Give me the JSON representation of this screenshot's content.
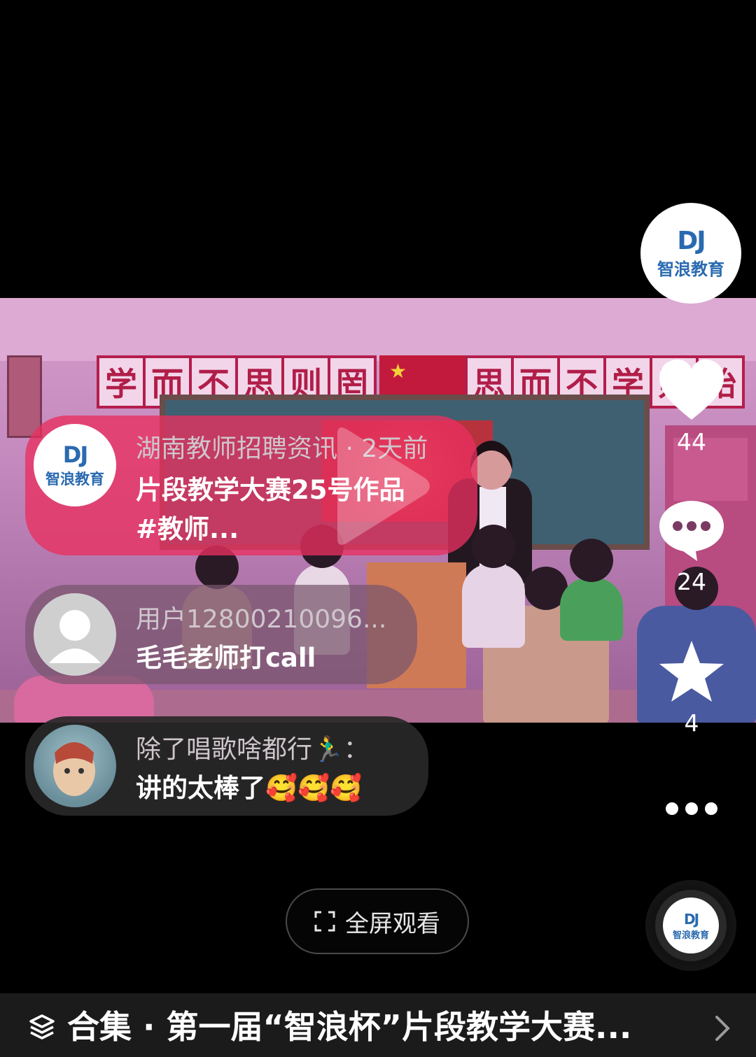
{
  "author": {
    "brand_name": "智浪教育",
    "brand_mark": "DJ"
  },
  "post": {
    "author_line": "湖南教师招聘资讯 · 2天前",
    "title_line1": "片段教学大赛25号作品",
    "title_line2": "#教师..."
  },
  "comments": [
    {
      "user": "用户12800210096...",
      "text": "毛毛老师打call"
    },
    {
      "user": "除了唱歌啥都行🏃‍♂️：",
      "text": "讲的太棒了🥰🥰🥰"
    }
  ],
  "actions": {
    "like_count": "44",
    "comment_count": "24",
    "favorite_count": "4"
  },
  "video": {
    "banner_left": [
      "学",
      "而",
      "不",
      "思",
      "则",
      "罔"
    ],
    "banner_right": [
      "思",
      "而",
      "不",
      "学",
      "则",
      "殆"
    ]
  },
  "fullscreen": {
    "label": "全屏观看"
  },
  "collection": {
    "label": "合集 · 第一届“智浪杯”片段教学大赛..."
  },
  "colors": {
    "like": "#ffffff",
    "bubble_post": "#e8305f",
    "bubble_comment": "#6b4f63"
  }
}
